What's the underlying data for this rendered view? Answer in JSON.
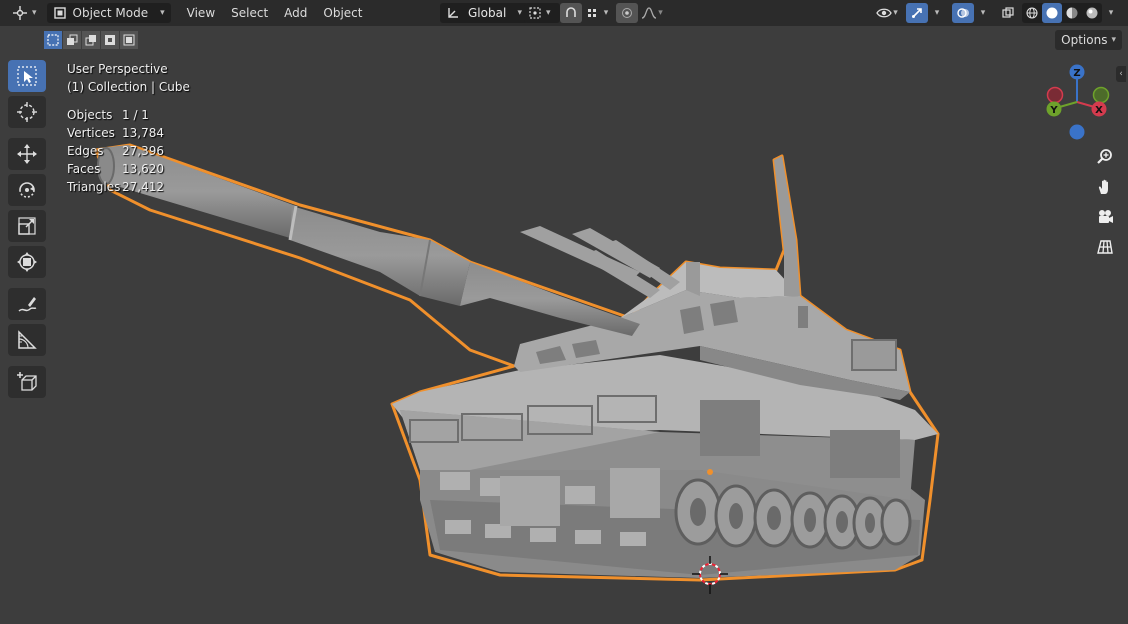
{
  "header": {
    "mode_label": "Object Mode",
    "menus": [
      "View",
      "Select",
      "Add",
      "Object"
    ],
    "transform_orientation": "Global"
  },
  "options_label": "Options",
  "overlay": {
    "view_name": "User Perspective",
    "collection_line": "(1) Collection | Cube",
    "stats": [
      {
        "label": "Objects",
        "value": "1 / 1"
      },
      {
        "label": "Vertices",
        "value": "13,784"
      },
      {
        "label": "Edges",
        "value": "27,396"
      },
      {
        "label": "Faces",
        "value": "13,620"
      },
      {
        "label": "Triangles",
        "value": "27,412"
      }
    ]
  },
  "gizmo": {
    "x": "X",
    "y": "Y",
    "z": "Z"
  },
  "colors": {
    "header_bg": "#2b2b2b",
    "viewport_bg": "#3d3d3d",
    "active_blue": "#4772b3",
    "selection_orange": "#f0902c",
    "axis_x": "#d43b4e",
    "axis_y": "#6ea22b",
    "axis_z": "#3a73c9"
  },
  "icons": [
    "editor-type-icon",
    "object-mode-icon",
    "transform-orientation-icon",
    "pivot-point-icon",
    "snap-icon",
    "snap-target-icon",
    "proportional-edit-icon",
    "falloff-icon",
    "visibility-icon",
    "gizmo-icon",
    "overlay-icon",
    "xray-icon",
    "shading-wireframe-icon",
    "shading-solid-icon",
    "shading-material-icon",
    "shading-rendered-icon",
    "select-box-icon",
    "cursor-icon",
    "move-icon",
    "rotate-icon",
    "scale-icon",
    "transform-icon",
    "annotate-icon",
    "measure-icon",
    "add-cube-icon",
    "zoom-icon",
    "hand-icon",
    "camera-icon",
    "ortho-grid-icon"
  ]
}
